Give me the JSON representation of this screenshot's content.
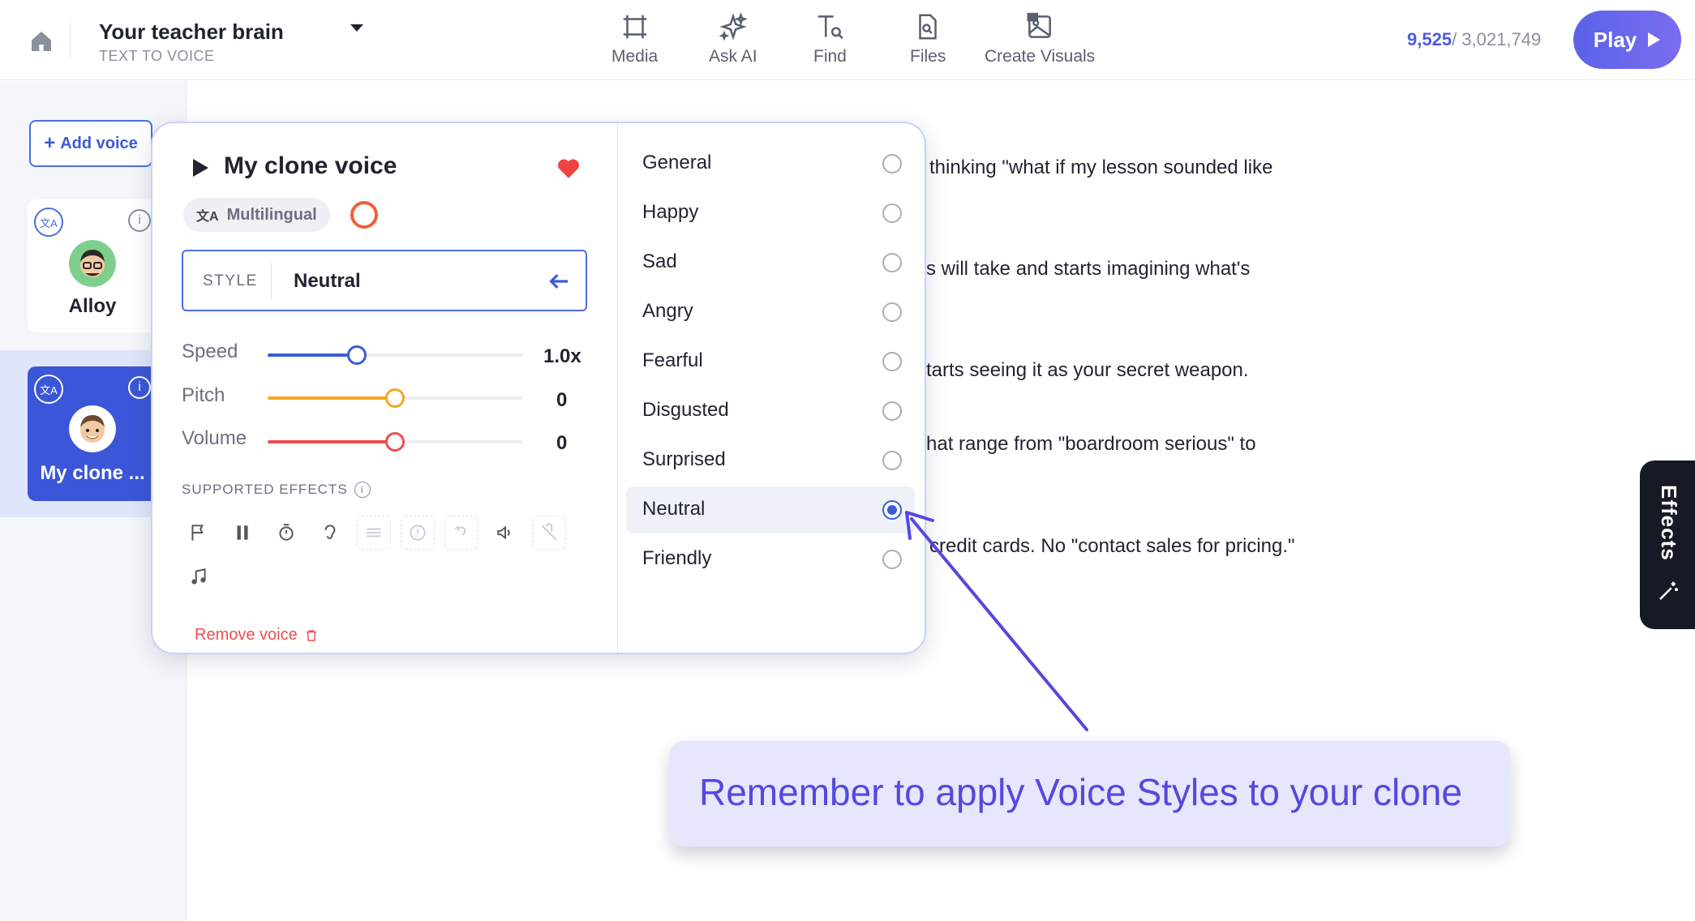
{
  "header": {
    "project_title": "Your teacher brain",
    "project_subtitle": "TEXT TO VOICE",
    "tools": [
      {
        "label": "Media",
        "icon": "media-icon"
      },
      {
        "label": "Ask AI",
        "icon": "sparkle-icon"
      },
      {
        "label": "Find",
        "icon": "find-text-icon"
      },
      {
        "label": "Files",
        "icon": "file-search-icon"
      },
      {
        "label": "Create Visuals",
        "icon": "image-icon"
      }
    ],
    "counter_current": "9,525",
    "counter_total": "/ 3,021,749",
    "play_label": "Play"
  },
  "sidebar": {
    "add_voice_label": "Add voice",
    "voices": [
      {
        "name": "Alloy",
        "selected": false
      },
      {
        "name": "My clone ...",
        "selected": true
      }
    ]
  },
  "document": {
    "lines": [
      "thinking \"what if my lesson sounded like",
      "s will take and starts imagining what's",
      "tarts seeing it as your secret weapon.",
      "hat range from \"boardroom serious\" to",
      "credit cards. No \"contact sales for pricing.\""
    ]
  },
  "voice_panel": {
    "voice_name": "My clone voice",
    "badge": "Multilingual",
    "style_label": "STYLE",
    "style_value": "Neutral",
    "sliders": [
      {
        "label": "Speed",
        "value": "1.0x",
        "level": 0.35,
        "color": "#3b5bd6"
      },
      {
        "label": "Pitch",
        "value": "0",
        "level": 0.5,
        "color": "#f5a623"
      },
      {
        "label": "Volume",
        "value": "0",
        "level": 0.5,
        "color": "#ea4f4f"
      }
    ],
    "supported_effects_label": "SUPPORTED EFFECTS",
    "remove_label": "Remove voice",
    "styles": [
      {
        "name": "General",
        "selected": false
      },
      {
        "name": "Happy",
        "selected": false
      },
      {
        "name": "Sad",
        "selected": false
      },
      {
        "name": "Angry",
        "selected": false
      },
      {
        "name": "Fearful",
        "selected": false
      },
      {
        "name": "Disgusted",
        "selected": false
      },
      {
        "name": "Surprised",
        "selected": false
      },
      {
        "name": "Neutral",
        "selected": true
      },
      {
        "name": "Friendly",
        "selected": false
      }
    ]
  },
  "effects_tab_label": "Effects",
  "callout_text": "Remember to apply Voice Styles to your clone",
  "colors": {
    "accent": "#3b5bd6",
    "callout_text": "#5548de",
    "heart": "#ef4444"
  }
}
